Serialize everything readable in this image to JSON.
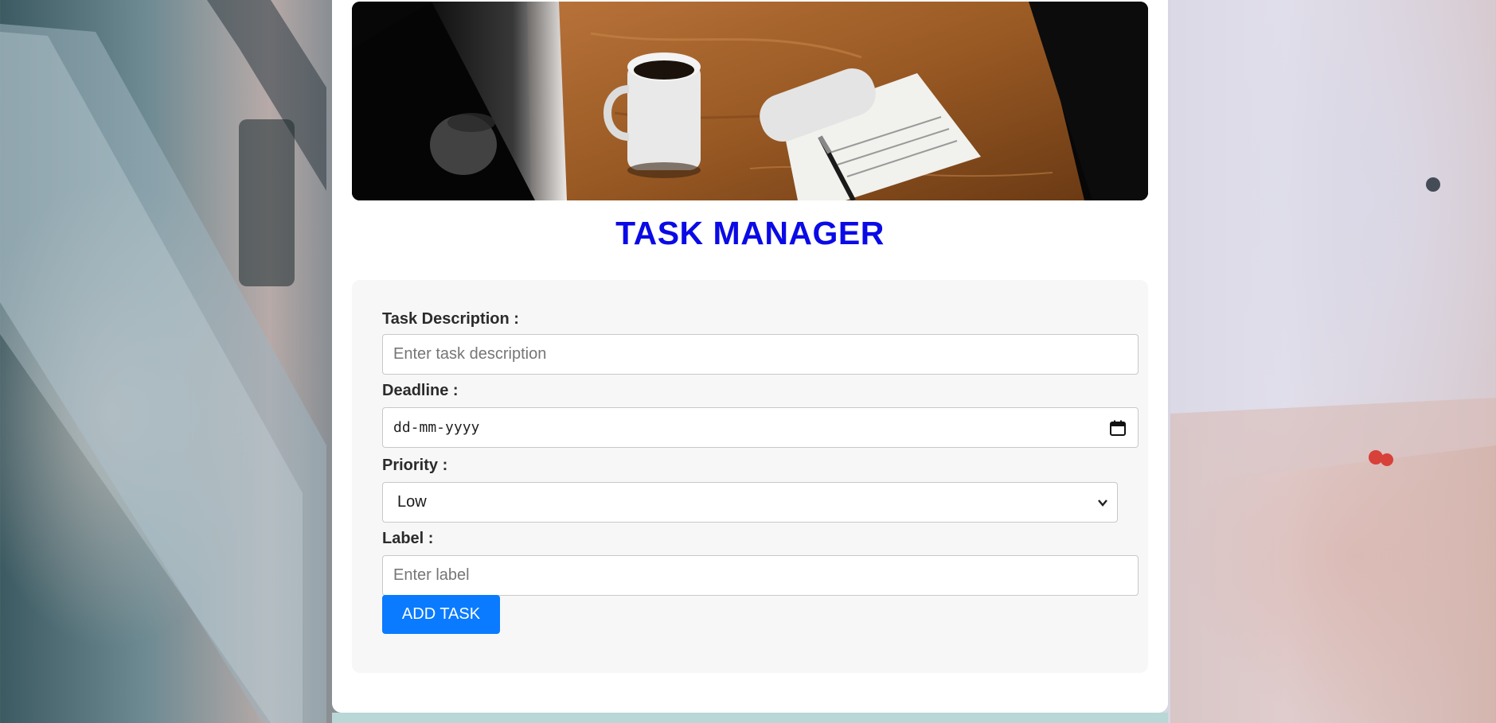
{
  "app": {
    "title": "TASK MANAGER"
  },
  "form": {
    "description": {
      "label": "Task Description :",
      "placeholder": "Enter task description",
      "value": ""
    },
    "deadline": {
      "label": "Deadline :",
      "value": "dd-mm-yyyy",
      "icon": "calendar-icon"
    },
    "priority": {
      "label": "Priority :",
      "selected": "Low",
      "icon": "chevron-down-icon"
    },
    "tag": {
      "label": "Label :",
      "placeholder": "Enter label",
      "value": ""
    },
    "submit_label": "ADD TASK"
  },
  "colors": {
    "title": "#0a0ae6",
    "button": "#0a7bff",
    "panel": "#f7f7f7"
  }
}
